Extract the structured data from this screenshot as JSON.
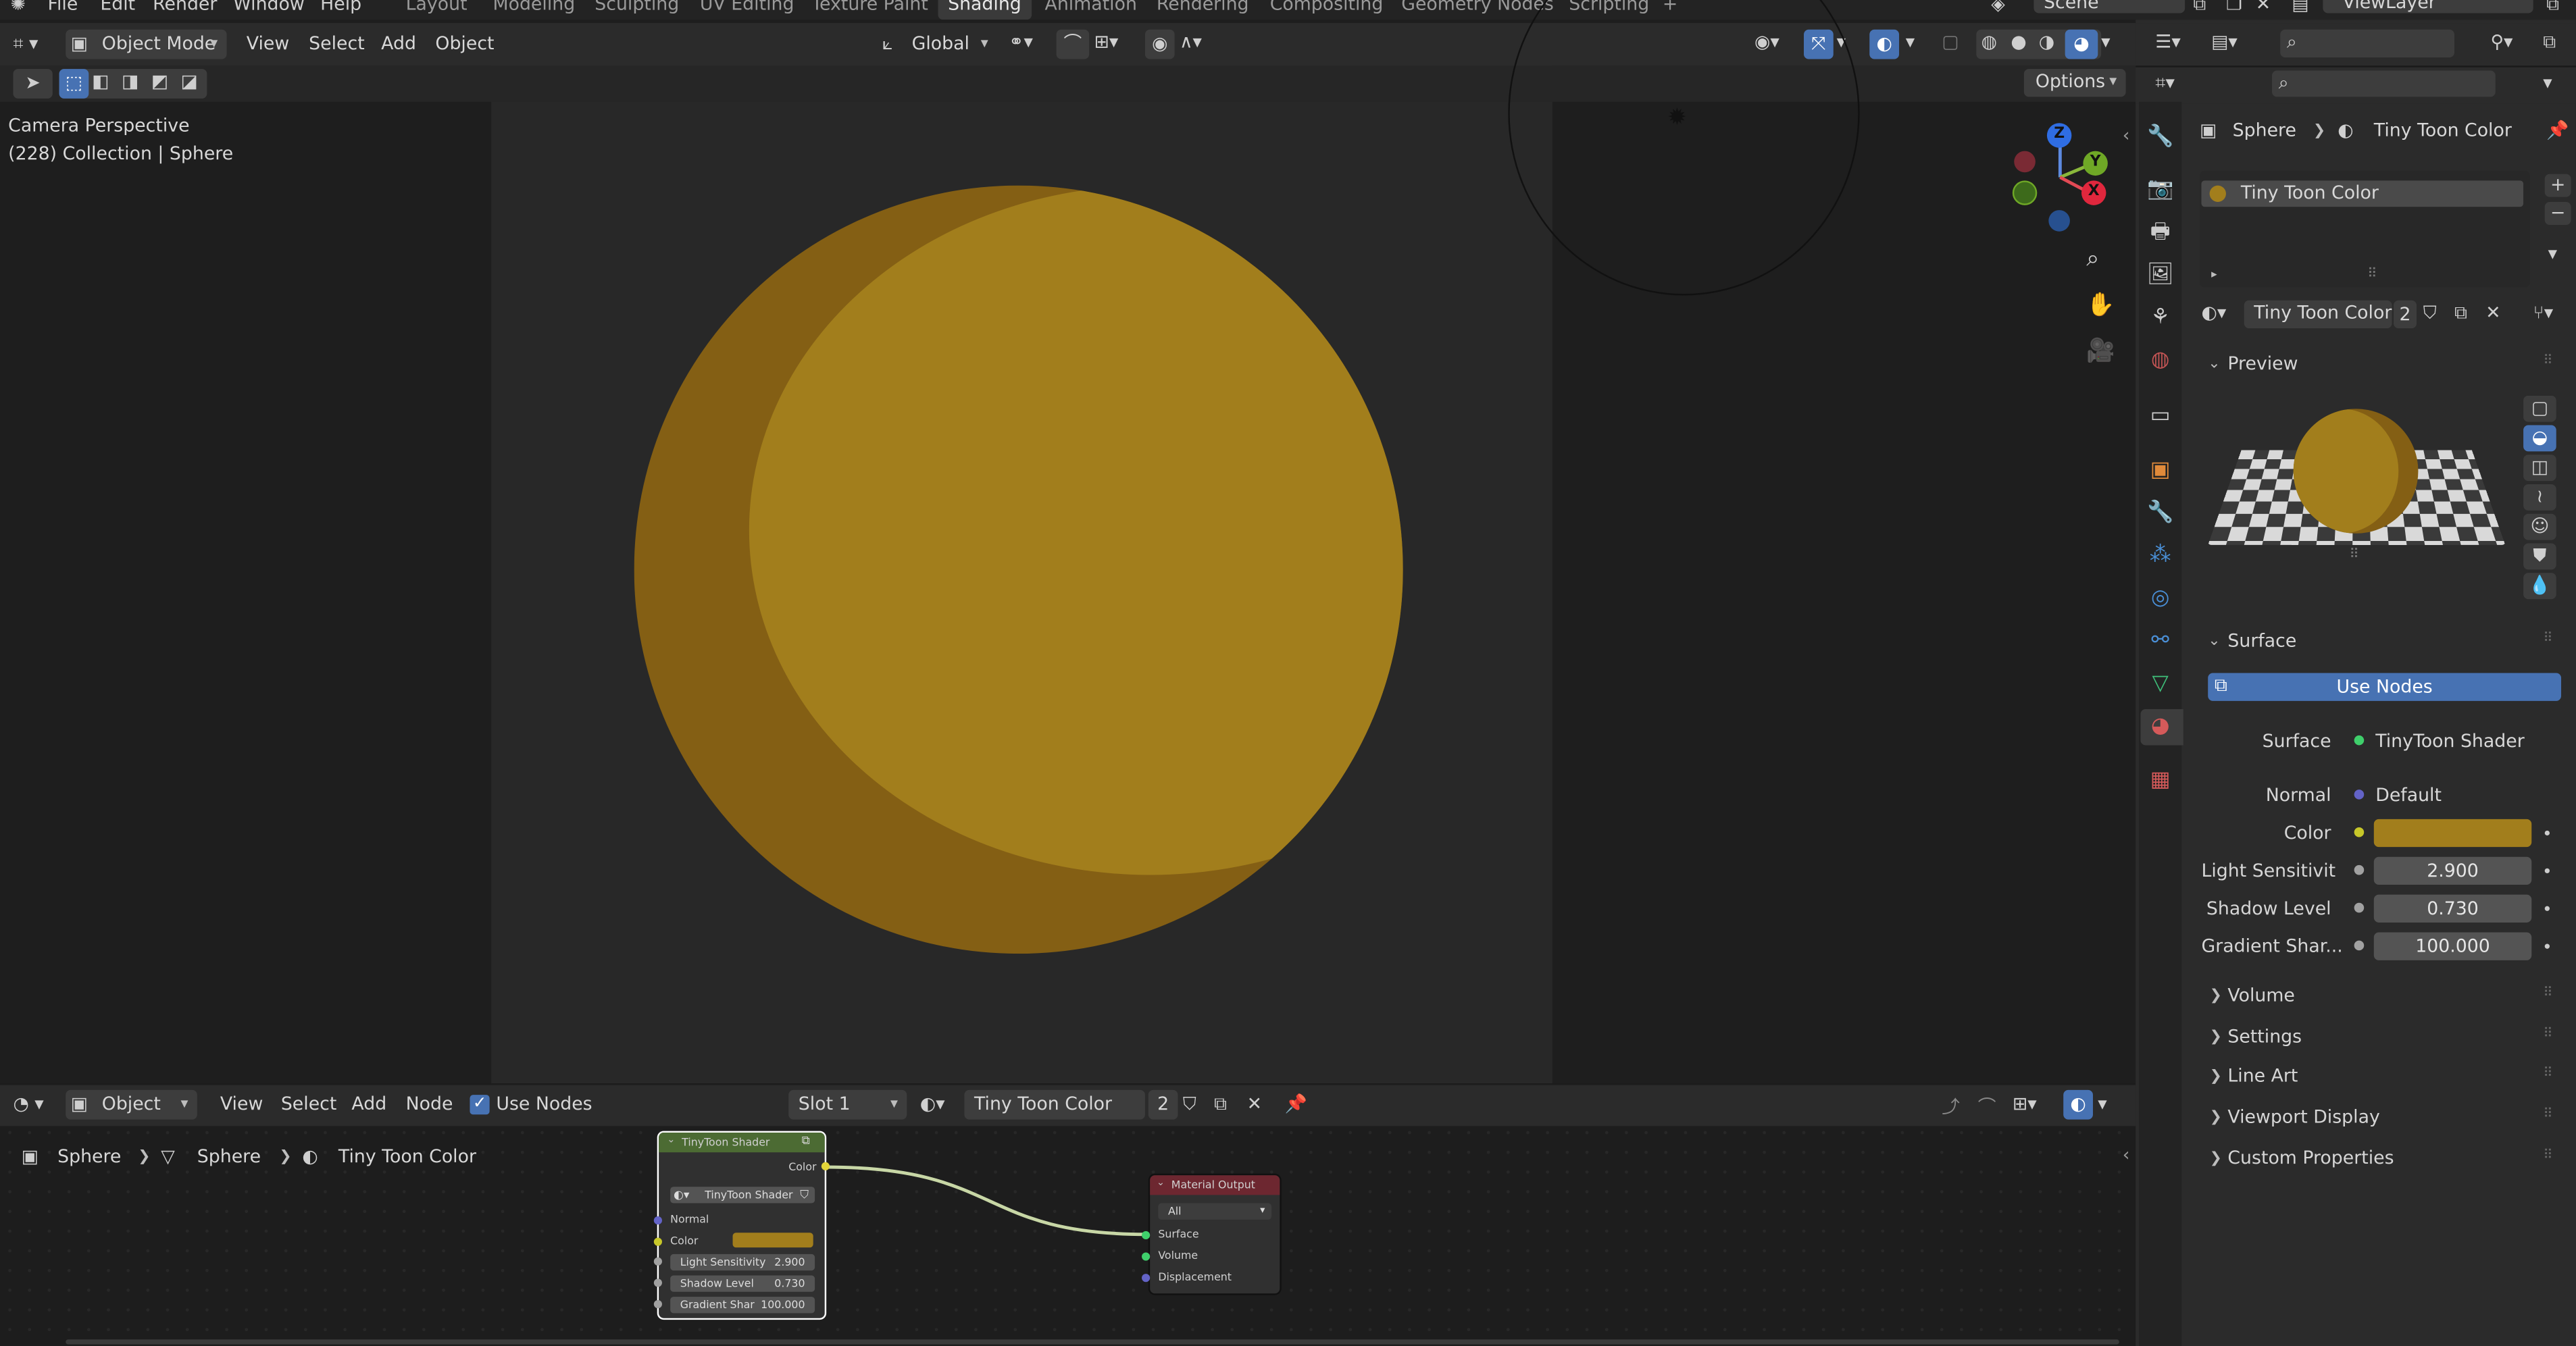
{
  "menus": [
    "File",
    "Edit",
    "Render",
    "Window",
    "Help"
  ],
  "workspaces": [
    "Layout",
    "Modeling",
    "Sculpting",
    "UV Editing",
    "Texture Paint",
    "Shading",
    "Animation",
    "Rendering",
    "Compositing",
    "Geometry Nodes",
    "Scripting"
  ],
  "active_workspace": "Shading",
  "add_workspace": "+",
  "scene": "Scene",
  "view_layer": "ViewLayer",
  "viewport": {
    "mode": "Object Mode",
    "menus": [
      "View",
      "Select",
      "Add",
      "Object"
    ],
    "transform_orientation": "Global",
    "options": "Options",
    "overlay_title": "Camera Perspective",
    "overlay_subtitle": "(228) Collection | Sphere",
    "gizmo": {
      "z": "Z",
      "y": "Y",
      "x": "X"
    },
    "sphere_color": "#a27e1c",
    "sphere_shadow_color": "#845f14"
  },
  "node_editor": {
    "type": "Object",
    "menus": [
      "View",
      "Select",
      "Add",
      "Node"
    ],
    "use_nodes_label": "Use Nodes",
    "slot": "Slot 1",
    "material": "Tiny Toon Color",
    "users": "2",
    "breadcrumb": [
      "Sphere",
      "Sphere",
      "Tiny Toon Color"
    ],
    "shader_node": {
      "title": "TinyToon Shader",
      "output": "Color",
      "group_name": "TinyToon Shader",
      "inputs": {
        "normal": "Normal",
        "color": "Color",
        "light_label": "Light Sensitivity",
        "light_value": "2.900",
        "shadow_label": "Shadow Level",
        "shadow_value": "0.730",
        "gradient_label": "Gradient Shar",
        "gradient_value": "100.000"
      }
    },
    "output_node": {
      "title": "Material Output",
      "target": "All",
      "inputs": [
        "Surface",
        "Volume",
        "Displacement"
      ]
    }
  },
  "properties": {
    "breadcrumb_object": "Sphere",
    "breadcrumb_material": "Tiny Toon Color",
    "material_slot": "Tiny Toon Color",
    "material_name": "Tiny Toon Color",
    "users": "2",
    "preview_label": "Preview",
    "surface_section": "Surface",
    "use_nodes_button": "Use Nodes",
    "surface_label": "Surface",
    "surface_value": "TinyToon Shader",
    "normal_label": "Normal",
    "normal_value": "Default",
    "color_label": "Color",
    "color_value": "#a27e1c",
    "light_label": "Light Sensitivit",
    "light_value": "2.900",
    "shadow_label": "Shadow Level",
    "shadow_value": "0.730",
    "gradient_label": "Gradient Shar...",
    "gradient_value": "100.000",
    "collapsed_sections": [
      "Volume",
      "Settings",
      "Line Art",
      "Viewport Display",
      "Custom Properties"
    ]
  }
}
